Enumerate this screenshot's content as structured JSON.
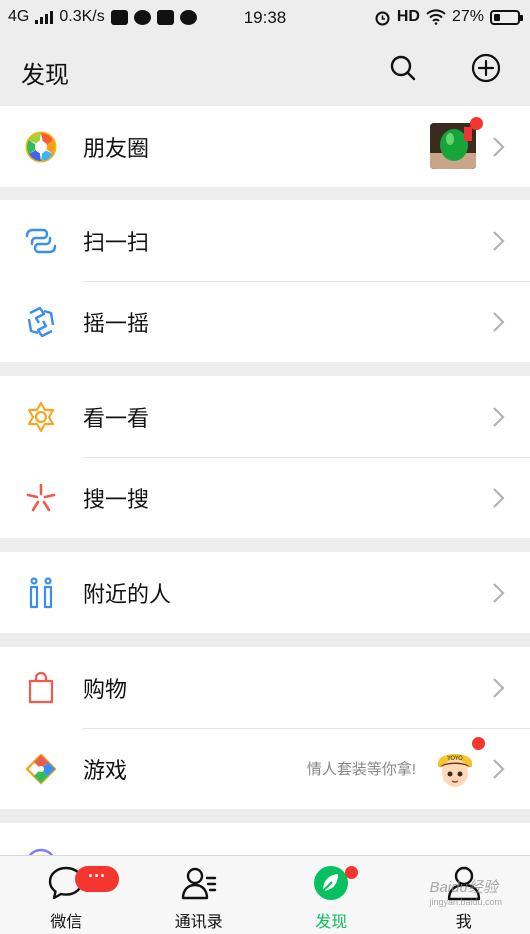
{
  "status_bar": {
    "network": "4G",
    "speed": "0.3K/s",
    "time": "19:38",
    "hd": "HD",
    "battery": "27%",
    "battery_level": 0.27
  },
  "header": {
    "title": "发现"
  },
  "menu": {
    "moments": "朋友圈",
    "scan": "扫一扫",
    "shake": "摇一摇",
    "top_stories": "看一看",
    "search": "搜一搜",
    "people_nearby": "附近的人",
    "shopping": "购物",
    "games": "游戏",
    "games_hint": "情人套装等你拿!"
  },
  "tabbar": {
    "chats": "微信",
    "chats_badge": "···",
    "contacts": "通讯录",
    "discover": "发现",
    "me": "我"
  },
  "colors": {
    "accent": "#07c160",
    "badge": "#f43530",
    "background": "#ededed"
  },
  "watermark": {
    "brand": "Baidu经验",
    "url": "jingyan.baidu.com"
  }
}
